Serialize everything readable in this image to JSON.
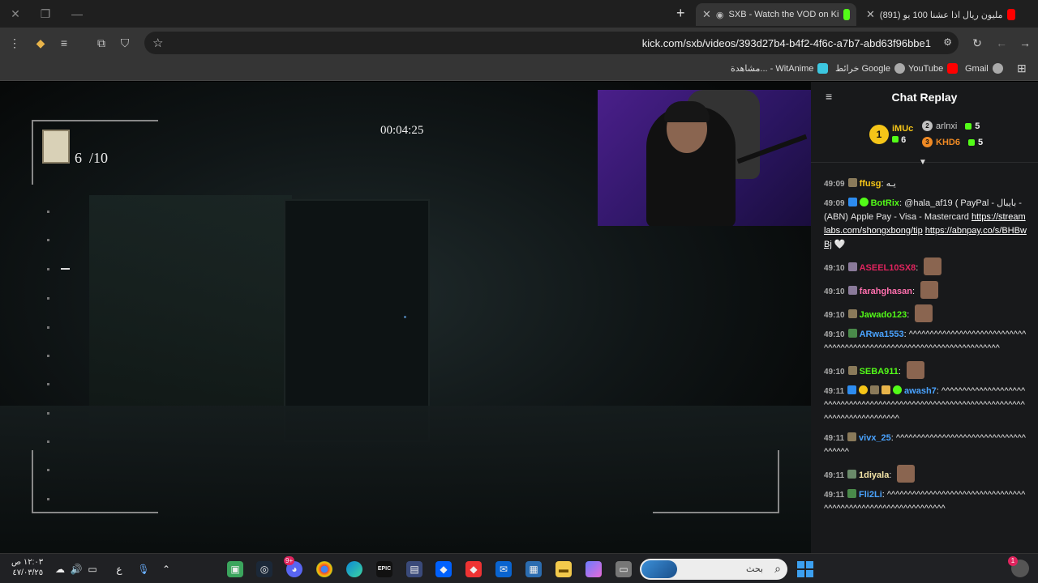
{
  "browser": {
    "tabs": [
      {
        "title": "(891) مليون ريال اذا عشنا 100 يو",
        "active": false
      },
      {
        "title": "SXB - Watch the VOD on Ki",
        "active": true
      }
    ],
    "url": "kick.com/sxb/videos/393d27b4-b4f2-4f6c-a7b7-abd63f96bbe1",
    "bookmarks": [
      "Gmail",
      "YouTube",
      "خرائط Google",
      "مشاهدة... - WitAnime"
    ]
  },
  "video": {
    "timer": "00:04:25",
    "collected": "6",
    "total": "/10"
  },
  "chat": {
    "title": "Chat Replay",
    "leaderboard": [
      {
        "rank": "1",
        "name": "iMUc",
        "count": "6",
        "color": "#f5c518"
      },
      {
        "rank": "2",
        "name": "arlnxi",
        "count": "5",
        "color": "#c0c0c0"
      },
      {
        "rank": "3",
        "name": "KHD6",
        "count": "5",
        "color": "#f08a24"
      }
    ],
    "messages": [
      {
        "time": "49:09",
        "user": "ffusg",
        "color": "#f5c518",
        "text": "يـه"
      },
      {
        "time": "49:09",
        "user": "BotRix",
        "color": "#53fc18",
        "text": "@hala_af19 ( PayPal - بايبال - (ABN) Apple Pay - Visa - Mastercard",
        "link1": "https://streamlabs.com/shongxbong/tip",
        "link2": "https://abnpay.co/s/BHBwBj",
        "tail": "🤍"
      },
      {
        "time": "49:10",
        "user": "ASEEL10SX8",
        "color": "#e0245e",
        "text": ""
      },
      {
        "time": "49:10",
        "user": "farahghasan",
        "color": "#ff6fae",
        "text": ""
      },
      {
        "time": "49:10",
        "user": "Jawado123",
        "color": "#53fc18",
        "text": ""
      },
      {
        "time": "49:10",
        "user": "ARwa1553",
        "color": "#4aa3ff",
        "text": "^^^^^^^^^^^^^^^^^^^^^^^^^^^^^^^^^^^^^^^^^^^^^^^^^^^^^^^^^^^^^^^^^^^^^^"
      },
      {
        "time": "49:10",
        "user": "SEBA911",
        "color": "#53fc18",
        "text": ""
      },
      {
        "time": "49:11",
        "user": "awash7",
        "color": "#4aa3ff",
        "text": "^^^^^^^^^^^^^^^^^^^^^^^^^^^^^^^^^^^^^^^^^^^^^^^^^^^^^^^^^^^^^^^^^^^^^^^^^^^^^^^^^^^^^^"
      },
      {
        "time": "49:11",
        "user": "vivx_25",
        "color": "#4aa3ff",
        "text": "^^^^^^^^^^^^^^^^^^^^^^^^^^^^^^^^^^^^^"
      },
      {
        "time": "49:11",
        "user": "1diyala",
        "color": "#f5e6a8",
        "text": ""
      },
      {
        "time": "49:11",
        "user": "Fli2Li",
        "color": "#4aa3ff",
        "text": "^^^^^^^^^^^^^^^^^^^^^^^^^^^^^^^^^^^^^^^^^^^^^^^^^^^^^^^^^^^^^^"
      }
    ]
  },
  "taskbar": {
    "time": "١٢:٠٣ ص",
    "date": "٤٧/٠٣/٢٥",
    "lang": "ع",
    "search_placeholder": "بحث",
    "notif_count": "1",
    "discord_badge": "9+"
  }
}
